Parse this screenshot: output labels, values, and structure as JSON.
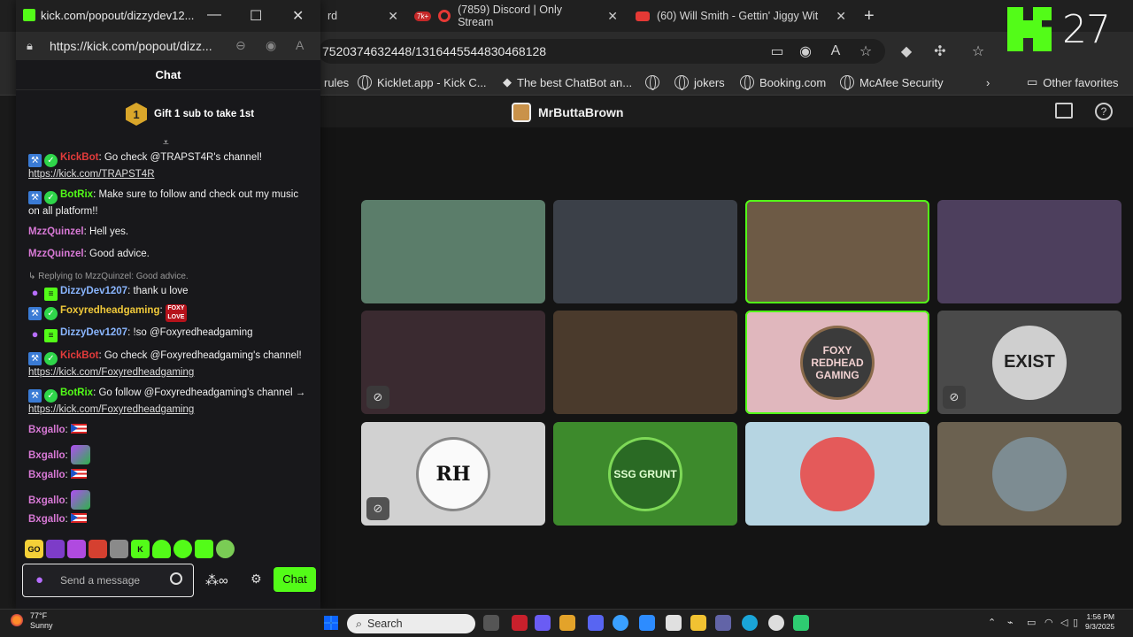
{
  "browser": {
    "tabs": [
      {
        "label": "rd"
      },
      {
        "label": "(7859) Discord | Only Stream"
      },
      {
        "label": "(60) Will Smith - Gettin' Jiggy Wit"
      }
    ],
    "notification_badge": "7k+",
    "url_fragment": "7520374632448/1316445544830468128",
    "bookmarks": [
      "rules",
      "Kicklet.app - Kick C...",
      "The best ChatBot an...",
      "jokers",
      "Booking.com",
      "McAfee Security",
      "Other favorites"
    ]
  },
  "overlay": {
    "count": "27"
  },
  "stream": {
    "host": "MrButtaBrown",
    "tiles": [
      {
        "name": "tile-1",
        "color": "#5b7d6a"
      },
      {
        "name": "tile-2",
        "color": "#3b4048"
      },
      {
        "name": "tile-3",
        "color": "#6d5a45"
      },
      {
        "name": "tile-4",
        "color": "#4d3f5d"
      },
      {
        "name": "tile-5",
        "color": "#3a2a30"
      },
      {
        "name": "tile-6",
        "color": "#4a3a2c"
      },
      {
        "name": "tile-7",
        "color": "#e0b7bd",
        "label": "FOXY REDHEAD GAMING"
      },
      {
        "name": "tile-8",
        "color": "#4a4a4a",
        "label": "EXIST"
      },
      {
        "name": "tile-9",
        "color": "#d1d1d1",
        "label": "RH"
      },
      {
        "name": "tile-10",
        "color": "#3d8a2c",
        "label": "SSG GRUNT"
      },
      {
        "name": "tile-11",
        "color": "#b6d5e2"
      },
      {
        "name": "tile-12",
        "color": "#6b6150"
      }
    ]
  },
  "popout": {
    "window_title": "kick.com/popout/dizzydev12...",
    "url": "https://kick.com/popout/dizz...",
    "chat_header": "Chat",
    "gift_rank": "1",
    "gift_text": "Gift 1 sub to take 1st",
    "messages": [
      {
        "user": "KickBot",
        "color": "#e33b3b",
        "text": ": Go check @TRAPST4R's channel!",
        "link": "https://kick.com/TRAPST4R"
      },
      {
        "user": "BotRix",
        "color": "#53fc18",
        "text": ": Make sure to follow and check out my music on all platform!!"
      },
      {
        "user": "MzzQuinzel",
        "color": "#d879d6",
        "text": ": Hell yes."
      },
      {
        "user": "MzzQuinzel",
        "color": "#d879d6",
        "text": ": Good advice."
      },
      {
        "reply": "Replying to MzzQuinzel: Good advice.",
        "user": "DizzyDev1207",
        "color": "#8ab6ff",
        "text": ": thank u love"
      },
      {
        "user": "Foxyredheadgaming",
        "color": "#f0c93a",
        "text": ":",
        "emote_label": "FOXY LOVE"
      },
      {
        "user": "DizzyDev1207",
        "color": "#8ab6ff",
        "text": ": !so @Foxyredheadgaming"
      },
      {
        "user": "KickBot",
        "color": "#e33b3b",
        "text": ": Go check @Foxyredheadgaming's channel!",
        "link": "https://kick.com/Foxyredheadgaming"
      },
      {
        "user": "BotRix",
        "color": "#53fc18",
        "text": ": Go follow @Foxyredheadgaming's channel →",
        "link": "https://kick.com/Foxyredheadgaming"
      },
      {
        "user": "Bxgallo",
        "color": "#d879d6",
        "text": ":"
      },
      {
        "user": "Bxgallo",
        "color": "#d879d6",
        "text": ":"
      },
      {
        "user": "Bxgallo",
        "color": "#d879d6",
        "text": ":"
      },
      {
        "user": "Bxgallo",
        "color": "#d879d6",
        "text": ":"
      },
      {
        "user": "Bxgallo",
        "color": "#d879d6",
        "text": ":"
      }
    ],
    "input_placeholder": "Send a message",
    "chat_button": "Chat"
  },
  "taskbar": {
    "weather_temp": "77°F",
    "weather_desc": "Sunny",
    "search": "Search",
    "time": "1:56 PM",
    "date": "9/3/2025"
  }
}
